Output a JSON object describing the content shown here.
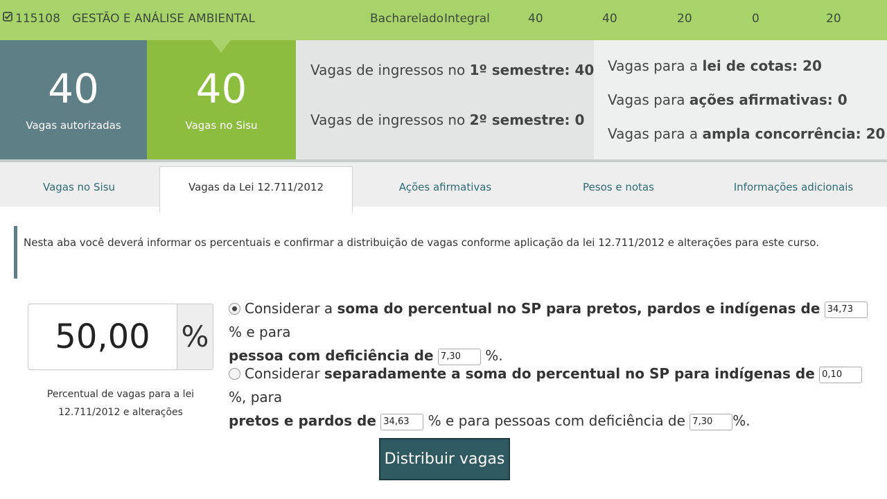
{
  "course": {
    "code": "115108",
    "name": "GESTÃO E ANÁLISE AMBIENTAL",
    "degree": "Bacharelado",
    "shift": "Integral",
    "values": [
      "40",
      "40",
      "20",
      "0",
      "20"
    ]
  },
  "summary": {
    "autorizadas": {
      "number": "40",
      "label": "Vagas autorizadas"
    },
    "sisu": {
      "number": "40",
      "label": "Vagas no Sisu"
    },
    "ingressos": {
      "sem1_prefix": "Vagas de ingressos no ",
      "sem1_bold": "1º semestre: 40",
      "sem2_prefix": "Vagas de ingressos no ",
      "sem2_bold": "2º semestre: 0"
    },
    "distribuicao": {
      "cotas_prefix": "Vagas para a ",
      "cotas_bold": "lei de cotas: 20",
      "acoes_prefix": "Vagas para ",
      "acoes_bold": "ações afirmativas: 0",
      "ampla_prefix": "Vagas para a ",
      "ampla_bold": "ampla concorrência: 20"
    }
  },
  "tabs": [
    {
      "label": "Vagas no Sisu",
      "active": false
    },
    {
      "label": "Vagas da Lei 12.711/2012",
      "active": true
    },
    {
      "label": "Ações afirmativas",
      "active": false
    },
    {
      "label": "Pesos e notas",
      "active": false
    },
    {
      "label": "Informações adicionais",
      "active": false
    }
  ],
  "note": "Nesta aba você deverá informar os percentuais e confirmar a distribuição de vagas conforme aplicação da lei 12.711/2012 e alterações para este curso.",
  "percent": {
    "value": "50,00",
    "symbol": "%",
    "caption_line1": "Percentual de vagas para a lei",
    "caption_line2": "12.711/2012 e alterações"
  },
  "option1": {
    "selected": true,
    "t1": "Considerar a ",
    "b1": "soma do percentual no SP para pretos, pardos e indígenas de",
    "input1": "34,73",
    "t2": "% e para",
    "b2": "pessoa com deficiência de",
    "input2": "7,30",
    "t3": "%."
  },
  "option2": {
    "selected": false,
    "t1": "Considerar ",
    "b1": "separadamente a soma do percentual no SP para indígenas de",
    "input1": "0,10",
    "t2": "%, para",
    "b2": "pretos e pardos de",
    "input2": "34,63",
    "t3": "% e para pessoas com deficiência de",
    "input3": "7,30",
    "t4": "%."
  },
  "button": {
    "label": "Distribuir vagas"
  },
  "colors": {
    "green_bar": "#a8d36a",
    "teal_box": "#5f7f87",
    "green_box": "#8cbd3e",
    "button": "#2f5a61"
  }
}
